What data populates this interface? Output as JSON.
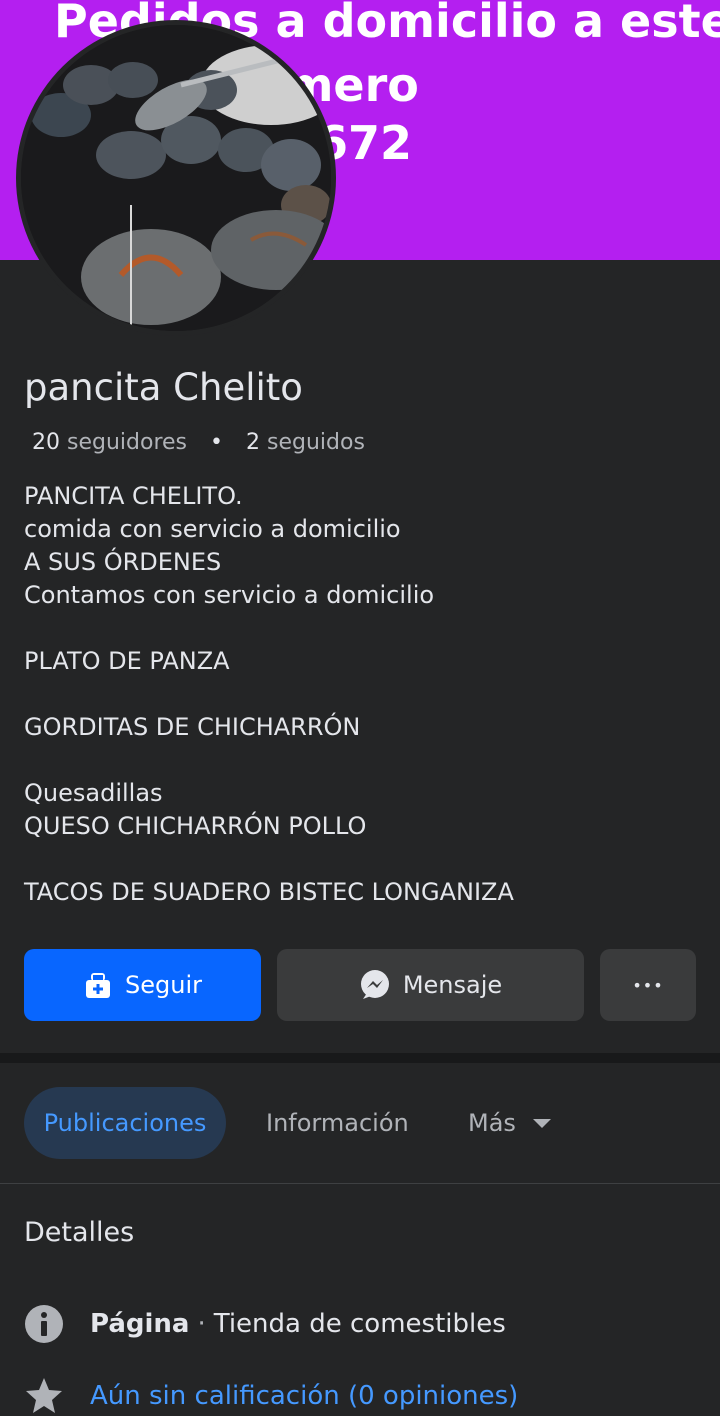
{
  "cover": {
    "line1": "Pedidos a domicilio a este",
    "line2": "número",
    "line3": "228672",
    "background": "#b41ff0"
  },
  "profile": {
    "name": "pancita Chelito",
    "followers_count": "20",
    "followers_label": "seguidores",
    "following_count": "2",
    "following_label": "seguidos"
  },
  "bio": {
    "lines": [
      "PANCITA CHELITO.",
      "comida con servicio a domicilio",
      "A SUS ÓRDENES",
      "Contamos con servicio a domicilio",
      "",
      "PLATO DE PANZA",
      "",
      "GORDITAS DE CHICHARRÓN",
      "",
      "Quesadillas",
      "QUESO CHICHARRÓN POLLO",
      "",
      "TACOS DE SUADERO BISTEC LONGANIZA"
    ]
  },
  "actions": {
    "follow_label": "Seguir",
    "message_label": "Mensaje",
    "more_label": "•••"
  },
  "tabs": {
    "posts": "Publicaciones",
    "info": "Información",
    "more": "Más"
  },
  "details": {
    "title": "Detalles",
    "page_label": "Página",
    "separator": "·",
    "category": "Tienda de comestibles",
    "rating": "Aún sin calificación (0 opiniones)"
  },
  "colors": {
    "accent": "#0866ff",
    "background": "#242526",
    "link": "#4599ff"
  }
}
